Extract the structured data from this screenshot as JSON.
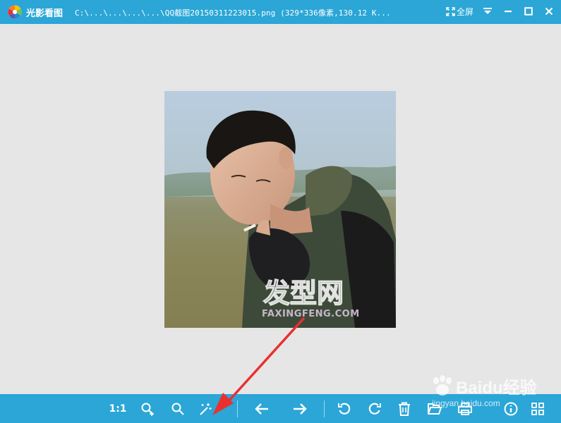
{
  "titlebar": {
    "app_name": "光影看图",
    "file_info": "C:\\...\\...\\...\\...\\QQ截图20150311223015.png (329*336像素,130.12 K...",
    "fullscreen_label": "全屏",
    "icons": [
      "app-logo-icon",
      "fullscreen-icon",
      "dropdown-icon",
      "minimize-icon",
      "maximize-icon",
      "close-icon"
    ]
  },
  "photo": {
    "watermark_cn": "发型网",
    "watermark_url": "FAXINGFENG.COM"
  },
  "toolbar": {
    "actual_size_label": "1:1",
    "icons": [
      "zoom-in-icon",
      "zoom-out-icon",
      "auto-enhance-icon",
      "previous-icon",
      "next-icon",
      "rotate-left-icon",
      "rotate-right-icon",
      "delete-icon",
      "open-folder-icon",
      "print-icon",
      "info-icon",
      "grid-view-icon"
    ]
  },
  "overlay": {
    "baidu_brand": "Baidu经验",
    "baidu_url": "jingyan.baidu.com"
  },
  "colors": {
    "accent": "#2ba6d7",
    "background": "#e6e6e6",
    "annotation_arrow": "#e8312f"
  }
}
